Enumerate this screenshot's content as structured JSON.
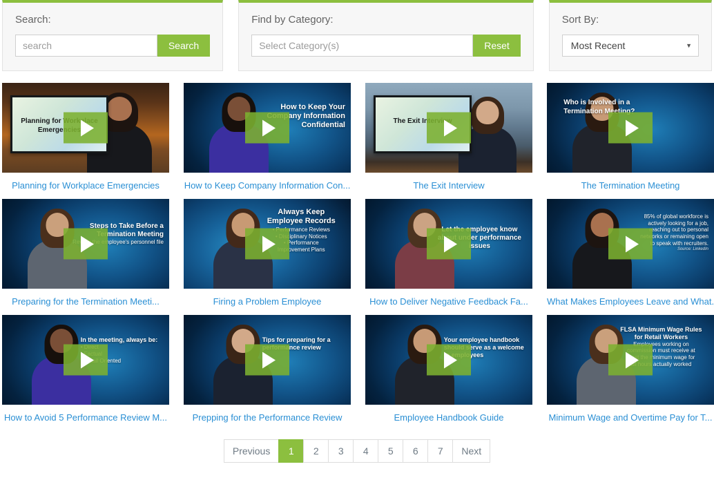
{
  "theme": {
    "accent_green": "#8cbf3f",
    "link_blue": "#2a8fd4",
    "panel_bg": "#f7f7f7"
  },
  "filters": {
    "search": {
      "label": "Search:",
      "input_value": "",
      "placeholder": "search",
      "button_label": "Search"
    },
    "category": {
      "label": "Find by Category:",
      "input_value": "",
      "placeholder": "Select Category(s)",
      "button_label": "Reset"
    },
    "sort": {
      "label": "Sort By:",
      "selected": "Most Recent",
      "caret": "▼"
    }
  },
  "videos": [
    {
      "title": "Planning for Workplace Emergencies",
      "scene": "studio",
      "slide_text": "Planning for Workplace Emergencies",
      "overlay": []
    },
    {
      "title": "How to Keep Company Information Con...",
      "scene": "blue",
      "slide_text": "",
      "overlay": [
        {
          "text": "How to Keep Your",
          "size": 11
        },
        {
          "text": "Company Information",
          "size": 11
        },
        {
          "text": "Confidential",
          "size": 11
        }
      ]
    },
    {
      "title": "The Exit Interview",
      "scene": "city",
      "slide_text": "The Exit Interview",
      "overlay": []
    },
    {
      "title": "The Termination Meeting",
      "scene": "blue",
      "slide_text": "",
      "overlay": [
        {
          "text": "Who is Involved in a",
          "size": 10
        },
        {
          "text": "Termination Meeting?",
          "size": 10
        }
      ]
    },
    {
      "title": "Preparing for the Termination Meeti...",
      "scene": "blue",
      "slide_text": "",
      "overlay": [
        {
          "text": "Steps to Take Before a",
          "size": 10
        },
        {
          "text": "Termination Meeting",
          "size": 10
        },
        {
          "text": "Review the employee's personnel file",
          "size": 8
        }
      ]
    },
    {
      "title": "Firing a Problem Employee",
      "scene": "blue2",
      "slide_text": "",
      "overlay": [
        {
          "text": "Always Keep",
          "size": 11
        },
        {
          "text": "Employee Records",
          "size": 11
        },
        {
          "text": "• Performance Reviews",
          "size": 8
        },
        {
          "text": "• Disciplinary Notices",
          "size": 8
        },
        {
          "text": "• Performance",
          "size": 8
        },
        {
          "text": "   Improvement Plans",
          "size": 8
        }
      ]
    },
    {
      "title": "How to Deliver Negative Feedback Fa...",
      "scene": "blue",
      "slide_text": "",
      "overlay": [
        {
          "text": "Let the employee know",
          "size": 10
        },
        {
          "text": "about under performance",
          "size": 10
        },
        {
          "text": "issues",
          "size": 10
        }
      ]
    },
    {
      "title": "What Makes Employees Leave and What...",
      "scene": "blue",
      "slide_text": "",
      "overlay": [
        {
          "text": "85% of global workforce is",
          "size": 8
        },
        {
          "text": "actively looking for a job,",
          "size": 8
        },
        {
          "text": "reaching out to personal",
          "size": 8
        },
        {
          "text": "networks or remaining open",
          "size": 8
        },
        {
          "text": "to speak with recruiters.",
          "size": 8
        },
        {
          "text": "Source: LinkedIn",
          "size": 6
        }
      ]
    },
    {
      "title": "How to Avoid 5 Performance Review M...",
      "scene": "blue",
      "slide_text": "",
      "overlay": [
        {
          "text": "In the meeting, always be:",
          "size": 9
        },
        {
          "text": "• Direct",
          "size": 8
        },
        {
          "text": "• Factual",
          "size": 8
        },
        {
          "text": "• Detail Oriented",
          "size": 8
        }
      ]
    },
    {
      "title": "Prepping for the Performance Review",
      "scene": "blue",
      "slide_text": "",
      "overlay": [
        {
          "text": "Tips for preparing for a",
          "size": 9
        },
        {
          "text": "performance review",
          "size": 9
        }
      ]
    },
    {
      "title": "Employee Handbook Guide",
      "scene": "blue",
      "slide_text": "",
      "overlay": [
        {
          "text": "Your employee handbook",
          "size": 9
        },
        {
          "text": "should serve as a welcome",
          "size": 9
        },
        {
          "text": "to employees",
          "size": 9
        }
      ]
    },
    {
      "title": "Minimum Wage and Overtime Pay for T...",
      "scene": "blue",
      "slide_text": "",
      "overlay": [
        {
          "text": "FLSA Minimum Wage Rules",
          "size": 9
        },
        {
          "text": "for Retail Workers",
          "size": 9
        },
        {
          "text": "Employees working on",
          "size": 8
        },
        {
          "text": "commission must receive at",
          "size": 8
        },
        {
          "text": "least the minimum wage for",
          "size": 8
        },
        {
          "text": "all hours actually worked",
          "size": 8
        }
      ]
    }
  ],
  "pagination": {
    "previous_label": "Previous",
    "next_label": "Next",
    "pages": [
      "1",
      "2",
      "3",
      "4",
      "5",
      "6",
      "7"
    ],
    "active_page": "1"
  },
  "icons": {
    "play": "play-icon",
    "caret": "chevron-down-icon"
  }
}
